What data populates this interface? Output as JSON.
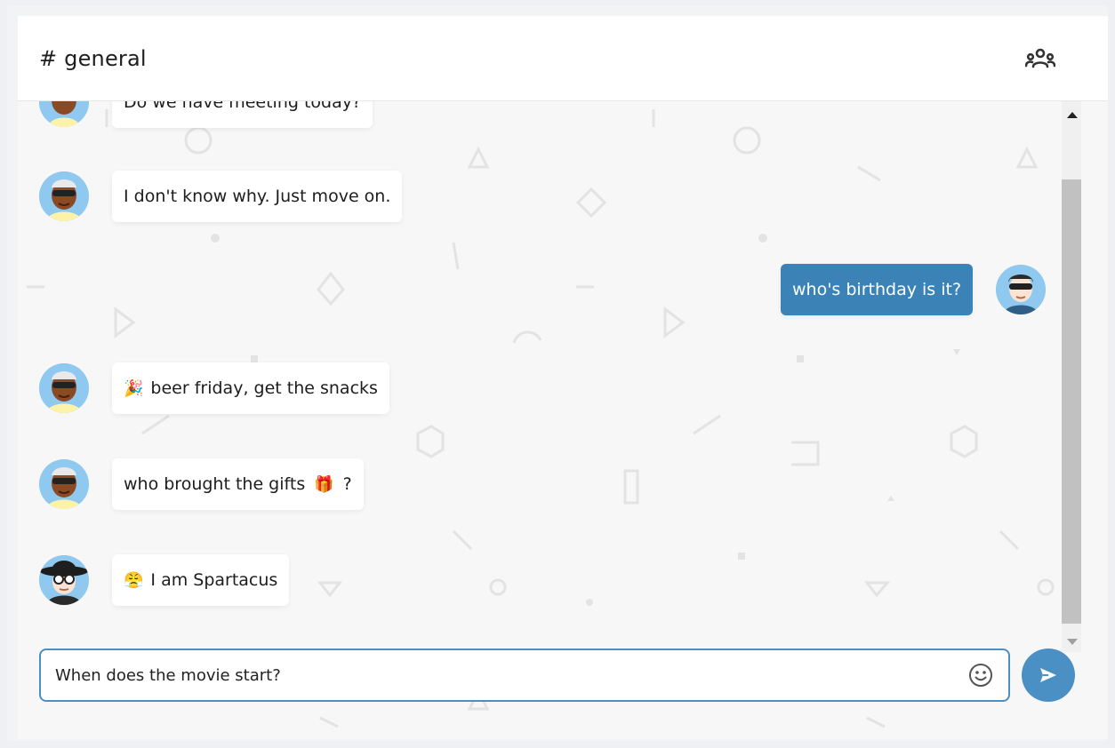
{
  "header": {
    "channel_title": "# general",
    "members_icon": "users-icon"
  },
  "messages": [
    {
      "author": "other-dark",
      "text": "Do we have meeting today?",
      "emoji": "",
      "mine": false
    },
    {
      "author": "other-dark",
      "text": "I don't know why. Just move on.",
      "emoji": "",
      "mine": false
    },
    {
      "author": "me",
      "text": "who's birthday is it?",
      "emoji": "",
      "mine": true
    },
    {
      "author": "other-dark",
      "text": "beer friday, get the snacks",
      "emoji": "🎉",
      "mine": false
    },
    {
      "author": "other-dark",
      "text": "who brought the gifts",
      "emoji_after": "🎁",
      "suffix": "?",
      "mine": false
    },
    {
      "author": "other-hat",
      "text": "I am Spartacus",
      "emoji": "😤",
      "mine": false
    }
  ],
  "composer": {
    "value": "When does the movie start?",
    "emoji_icon": "smiley-icon",
    "send_icon": "send-icon"
  },
  "colors": {
    "accent": "#3b82b6",
    "input_border": "#4b8fc3",
    "send_button": "#4b90c4"
  }
}
